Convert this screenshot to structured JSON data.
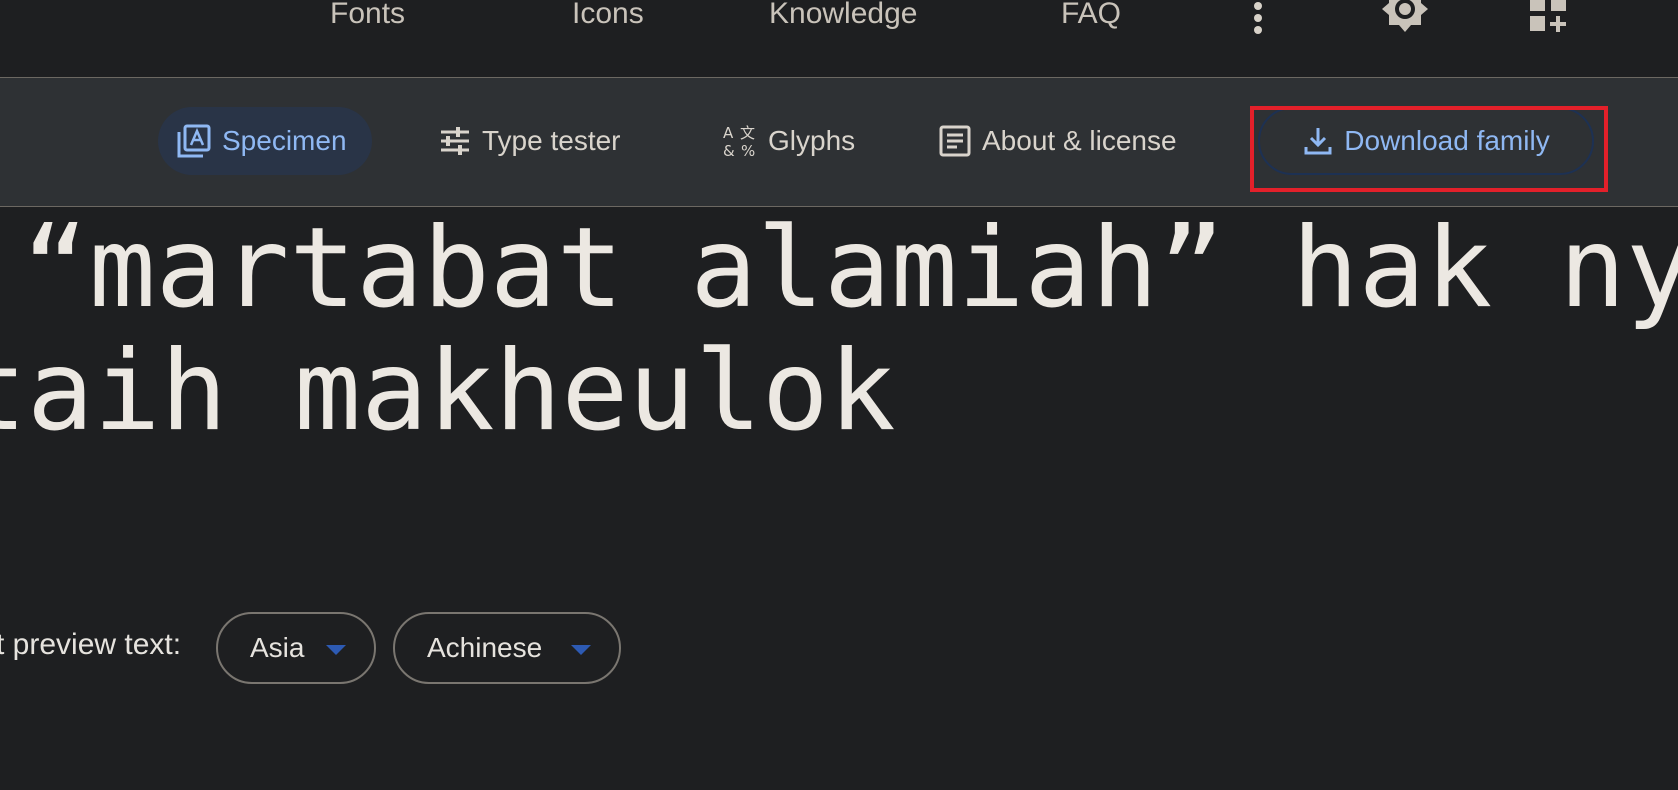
{
  "top_nav": {
    "links": [
      "Fonts",
      "Icons",
      "Knowledge",
      "FAQ"
    ],
    "more_icon": "more-vert-icon",
    "theme_icon": "brightness-icon",
    "apps_icon": "apps-add-icon"
  },
  "tabs": {
    "specimen": "Specimen",
    "type_tester": "Type tester",
    "glyphs": "Glyphs",
    "about": "About & license",
    "download": "Download family"
  },
  "preview": {
    "line1": "“martabat alamiah” hak nyang",
    "line2": "taih makheulok"
  },
  "preview_selector": {
    "label": "t preview text:",
    "region": "Asia",
    "language": "Achinese"
  },
  "colors": {
    "accent": "#8fb8f3",
    "highlight": "#e3202a",
    "background": "#1e1f21",
    "tabbar": "#2e3134"
  }
}
